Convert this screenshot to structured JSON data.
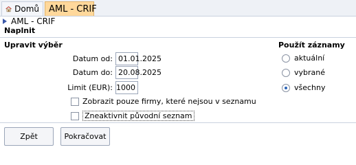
{
  "tabs": {
    "home_label": "Domů",
    "active_label": "AML - CRIF"
  },
  "breadcrumb": {
    "label": "AML - CRIF"
  },
  "section": {
    "title": "Naplnit"
  },
  "left_group": {
    "title": "Upravit výběr",
    "fields": [
      {
        "label": "Datum od:",
        "value": "01.01.2025"
      },
      {
        "label": "Datum do:",
        "value": "20.08.2025"
      },
      {
        "label": "Limit (EUR):",
        "value": "1000"
      }
    ],
    "checkboxes": [
      {
        "label": "Zobrazit pouze firmy, které nejsou v seznamu",
        "checked": false
      },
      {
        "label": "Zneaktivnit původní seznam",
        "checked": false
      }
    ]
  },
  "right_group": {
    "title": "Použít záznamy",
    "options": [
      {
        "label": "aktuální",
        "selected": false
      },
      {
        "label": "vybrané",
        "selected": false
      },
      {
        "label": "všechny",
        "selected": true
      }
    ]
  },
  "buttons": {
    "back_label": "Zpět",
    "continue_label": "Pokračovat"
  },
  "colors": {
    "active_tab": "#ffd89b",
    "accent": "#3b58a8"
  }
}
